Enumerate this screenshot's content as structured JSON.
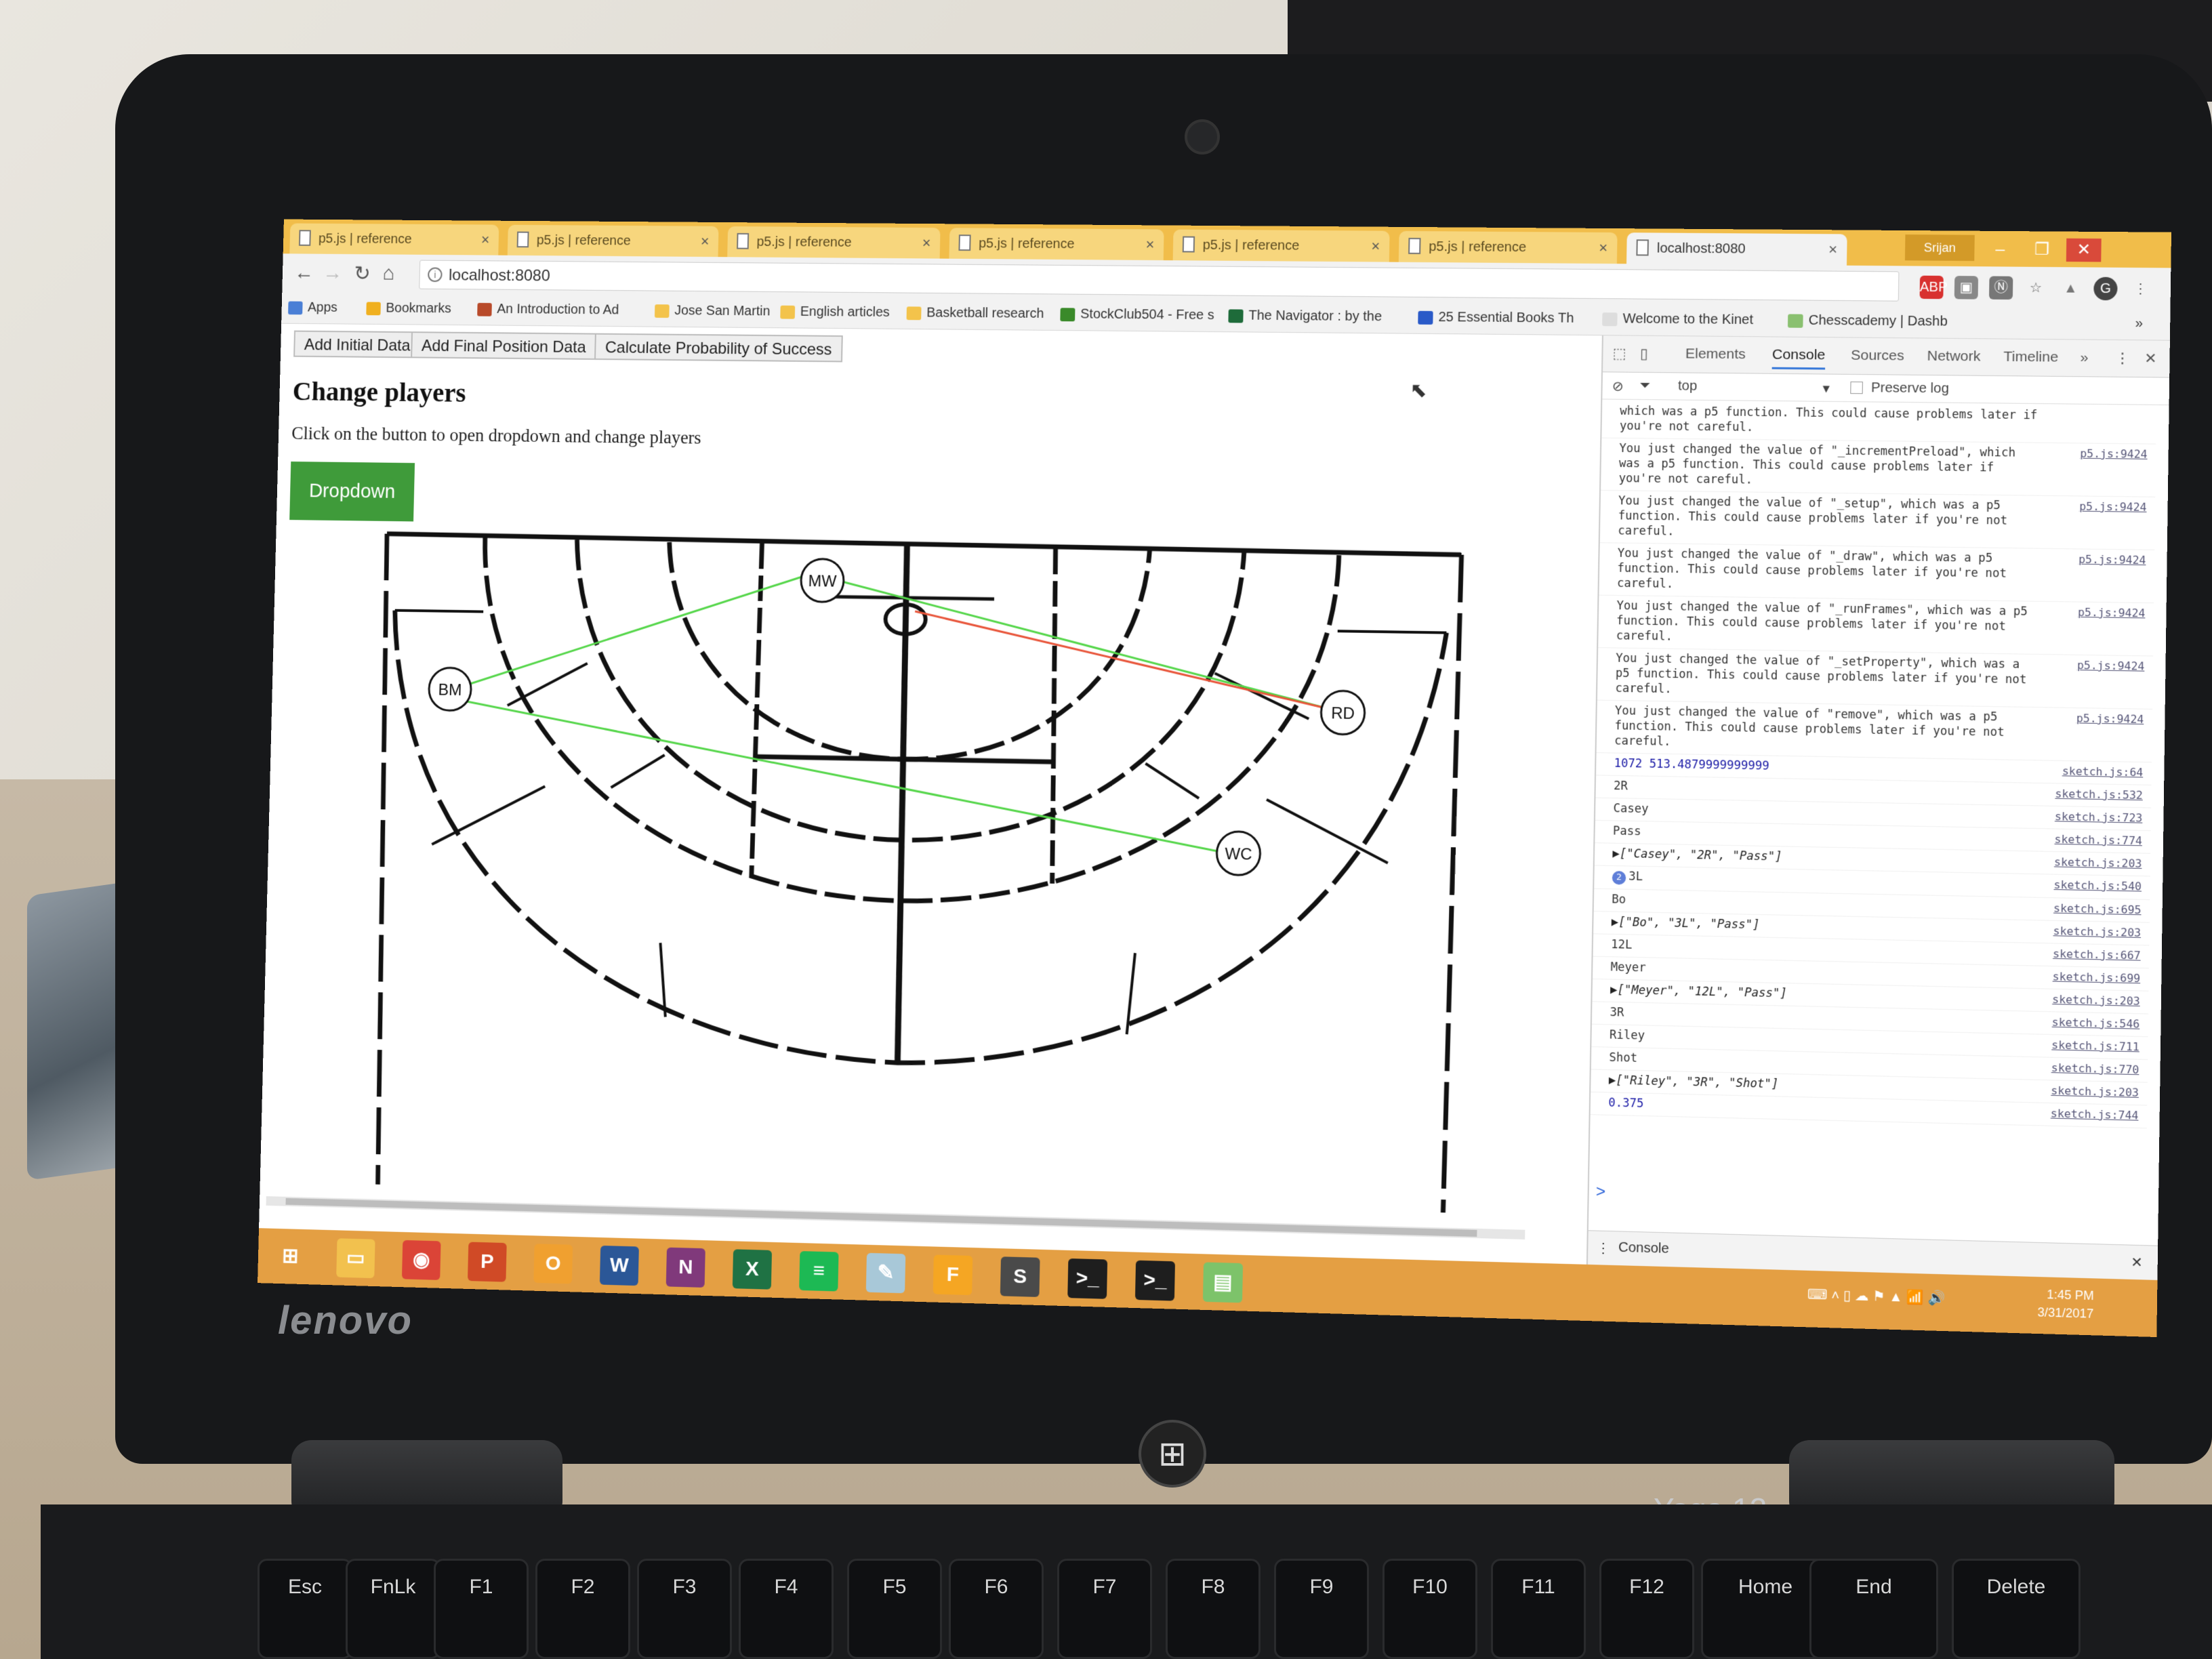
{
  "laptop": {
    "brand": "lenovo",
    "model": "Yoga 12",
    "keys": [
      "Esc",
      "FnLk",
      "F1",
      "F2",
      "F3",
      "F4",
      "F5",
      "F6",
      "F7",
      "F8",
      "F9",
      "F10",
      "F11",
      "F12",
      "Home",
      "End",
      "Delete"
    ]
  },
  "browser": {
    "tabs": [
      {
        "title": "p5.js | reference"
      },
      {
        "title": "p5.js | reference"
      },
      {
        "title": "p5.js | reference"
      },
      {
        "title": "p5.js | reference"
      },
      {
        "title": "p5.js | reference"
      },
      {
        "title": "p5.js | reference"
      },
      {
        "title": "localhost:8080"
      }
    ],
    "profile": "Srijan",
    "url": "localhost:8080",
    "bookmarks": [
      {
        "label": "Apps",
        "icon_color": "#4a7fd6"
      },
      {
        "label": "Bookmarks",
        "icon_color": "#f0b020"
      },
      {
        "label": "An Introduction to Ad",
        "icon_color": "#b84a2a"
      },
      {
        "label": "Jose San Martin",
        "icon_color": "#f3c34b"
      },
      {
        "label": "English articles",
        "icon_color": "#f3c34b"
      },
      {
        "label": "Basketball research",
        "icon_color": "#f3c34b"
      },
      {
        "label": "StockClub504 - Free s",
        "icon_color": "#3a8a2a"
      },
      {
        "label": "The Navigator : by the",
        "icon_color": "#1e6b3a"
      },
      {
        "label": "25 Essential Books Th",
        "icon_color": "#2a5ac8"
      },
      {
        "label": "Welcome to the Kinet",
        "icon_color": "#dddddd"
      },
      {
        "label": "Chesscademy | Dashb",
        "icon_color": "#8ac070"
      }
    ]
  },
  "page": {
    "buttons": [
      "Add Initial Data",
      "Add Final Position Data",
      "Calculate Probability of Success"
    ],
    "heading": "Change players",
    "subtext": "Click on the button to open dropdown and change players",
    "dropdown_label": "Dropdown",
    "players": [
      {
        "label": "MW"
      },
      {
        "label": "BM"
      },
      {
        "label": "RD"
      },
      {
        "label": "WC"
      }
    ],
    "colors": {
      "pass_line": "#55d64a",
      "shot_line": "#e8553a",
      "dropdown": "#3f9b3a"
    }
  },
  "devtools": {
    "tabs": [
      "Elements",
      "Console",
      "Sources",
      "Network",
      "Timeline"
    ],
    "active_tab": "Console",
    "context": "top",
    "preserve_log": "Preserve log",
    "logs": [
      {
        "text": "which was a p5 function. This could cause problems later if you're not careful.",
        "src": ""
      },
      {
        "text": "You just changed the value of \"_incrementPreload\", which was a p5 function. This could cause problems later if you're not careful.",
        "src": "p5.js:9424"
      },
      {
        "text": "You just changed the value of \"_setup\", which was a p5 function. This could cause problems later if you're not careful.",
        "src": "p5.js:9424"
      },
      {
        "text": "You just changed the value of \"_draw\", which was a p5 function. This could cause problems later if you're not careful.",
        "src": "p5.js:9424"
      },
      {
        "text": "You just changed the value of \"_runFrames\", which was a p5 function. This could cause problems later if you're not careful.",
        "src": "p5.js:9424"
      },
      {
        "text": "You just changed the value of \"_setProperty\", which was a p5 function. This could cause problems later if you're not careful.",
        "src": "p5.js:9424"
      },
      {
        "text": "You just changed the value of \"remove\", which was a p5 function. This could cause problems later if you're not careful.",
        "src": "p5.js:9424"
      }
    ],
    "values": [
      {
        "text": "1072 513.4879999999999",
        "src": "sketch.js:64",
        "kind": "num"
      },
      {
        "text": "2R",
        "src": "sketch.js:532",
        "kind": "plain"
      },
      {
        "text": "Casey",
        "src": "sketch.js:723",
        "kind": "plain"
      },
      {
        "text": "Pass",
        "src": "sketch.js:774",
        "kind": "plain"
      },
      {
        "text": "▶[\"Casey\", \"2R\", \"Pass\"]",
        "src": "sketch.js:203",
        "kind": "arr"
      },
      {
        "text": "3L",
        "src": "sketch.js:540",
        "kind": "badge",
        "badge": "2"
      },
      {
        "text": "Bo",
        "src": "sketch.js:695",
        "kind": "plain"
      },
      {
        "text": "▶[\"Bo\", \"3L\", \"Pass\"]",
        "src": "sketch.js:203",
        "kind": "arr"
      },
      {
        "text": "12L",
        "src": "sketch.js:667",
        "kind": "plain"
      },
      {
        "text": "Meyer",
        "src": "sketch.js:699",
        "kind": "plain"
      },
      {
        "text": "▶[\"Meyer\", \"12L\", \"Pass\"]",
        "src": "sketch.js:203",
        "kind": "arr"
      },
      {
        "text": "3R",
        "src": "sketch.js:546",
        "kind": "plain"
      },
      {
        "text": "Riley",
        "src": "sketch.js:711",
        "kind": "plain"
      },
      {
        "text": "Shot",
        "src": "sketch.js:770",
        "kind": "plain"
      },
      {
        "text": "▶[\"Riley\", \"3R\", \"Shot\"]",
        "src": "sketch.js:203",
        "kind": "arr"
      },
      {
        "text": "0.375",
        "src": "sketch.js:744",
        "kind": "num"
      }
    ],
    "prompt": ">",
    "drawer_tab": "Console"
  },
  "taskbar": {
    "apps": [
      {
        "name": "start",
        "color": "#e49f43",
        "glyph": "⊞"
      },
      {
        "name": "file-explorer",
        "color": "#f2c14e",
        "glyph": "▭"
      },
      {
        "name": "chrome",
        "color": "#db4437",
        "glyph": "◉"
      },
      {
        "name": "powerpoint",
        "color": "#d04a26",
        "glyph": "P"
      },
      {
        "name": "outlook",
        "color": "#f0a030",
        "glyph": "O"
      },
      {
        "name": "word",
        "color": "#2b5797",
        "glyph": "W"
      },
      {
        "name": "onenote",
        "color": "#80397b",
        "glyph": "N"
      },
      {
        "name": "excel",
        "color": "#1f7244",
        "glyph": "X"
      },
      {
        "name": "spotify",
        "color": "#1db954",
        "glyph": "≡"
      },
      {
        "name": "notepad",
        "color": "#a8c8d8",
        "glyph": "✎"
      },
      {
        "name": "fl-app",
        "color": "#f5a623",
        "glyph": "F"
      },
      {
        "name": "sublime",
        "color": "#4a4a4a",
        "glyph": "S"
      },
      {
        "name": "cmd",
        "color": "#1e1e1e",
        "glyph": ">_"
      },
      {
        "name": "cmd-2",
        "color": "#1e1e1e",
        "glyph": ">_"
      },
      {
        "name": "sticky",
        "color": "#7dc36a",
        "glyph": "▤"
      }
    ],
    "time": "1:45 PM",
    "date": "3/31/2017"
  }
}
